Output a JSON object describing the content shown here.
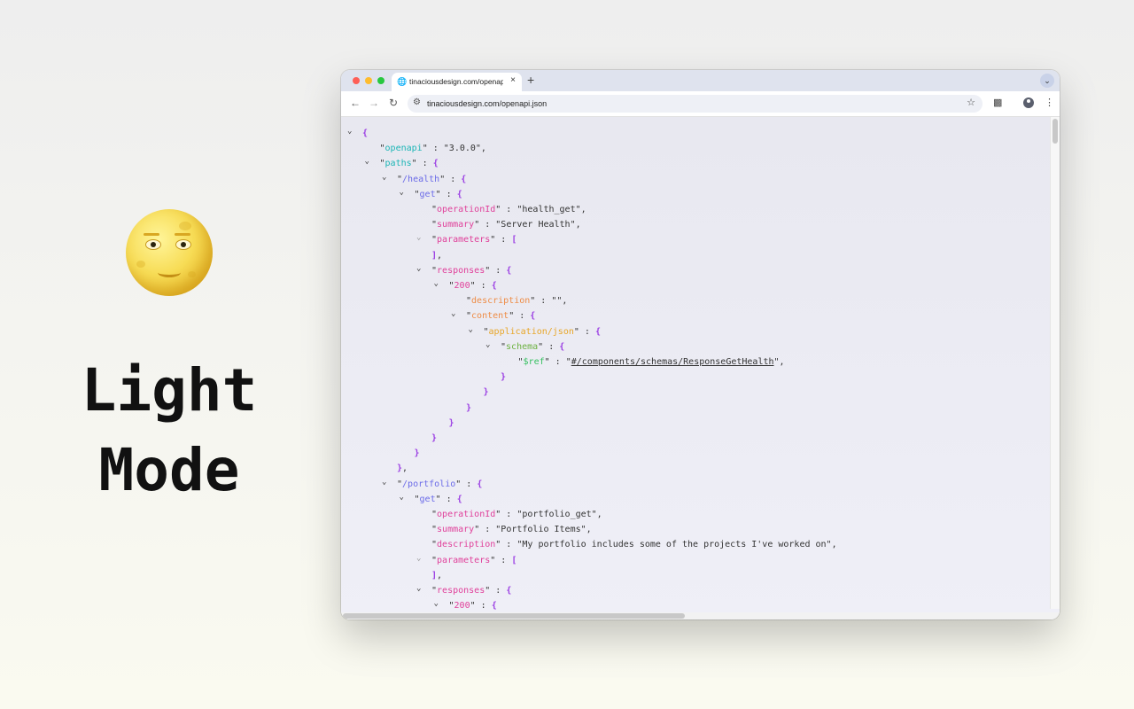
{
  "promo": {
    "line1": "Light",
    "line2": "Mode"
  },
  "browser": {
    "tab_title": "tinaciousdesign.com/openapi.json",
    "new_tab": "+",
    "tab_close": "×",
    "url": "tinaciousdesign.com/openapi.json"
  },
  "json_lines": [
    {
      "indent": 0,
      "caret": "open",
      "parts": [
        [
          "b",
          "{"
        ]
      ]
    },
    {
      "indent": 1,
      "caret": "none",
      "parts": [
        [
          "q",
          "\""
        ],
        [
          "k-teal",
          "openapi"
        ],
        [
          "q",
          "\" : "
        ],
        [
          "s",
          "\"3.0.0\","
        ]
      ]
    },
    {
      "indent": 1,
      "caret": "open",
      "parts": [
        [
          "q",
          "\""
        ],
        [
          "k-teal",
          "paths"
        ],
        [
          "q",
          "\" : "
        ],
        [
          "b",
          "{"
        ]
      ]
    },
    {
      "indent": 2,
      "caret": "open",
      "parts": [
        [
          "q",
          "\""
        ],
        [
          "k-blue",
          "/health"
        ],
        [
          "q",
          "\" : "
        ],
        [
          "b",
          "{"
        ]
      ]
    },
    {
      "indent": 3,
      "caret": "open",
      "parts": [
        [
          "q",
          "\""
        ],
        [
          "k-blue",
          "get"
        ],
        [
          "q",
          "\" : "
        ],
        [
          "b",
          "{"
        ]
      ]
    },
    {
      "indent": 4,
      "caret": "none",
      "parts": [
        [
          "q",
          "\""
        ],
        [
          "k-pink",
          "operationId"
        ],
        [
          "q",
          "\" : "
        ],
        [
          "s",
          "\"health_get\","
        ]
      ]
    },
    {
      "indent": 4,
      "caret": "none",
      "parts": [
        [
          "q",
          "\""
        ],
        [
          "k-pink",
          "summary"
        ],
        [
          "q",
          "\" : "
        ],
        [
          "s",
          "\"Server Health\","
        ]
      ]
    },
    {
      "indent": 4,
      "caret": "dim",
      "parts": [
        [
          "q",
          "\""
        ],
        [
          "k-pink",
          "parameters"
        ],
        [
          "q",
          "\" : "
        ],
        [
          "b",
          "["
        ]
      ]
    },
    {
      "indent": 4,
      "caret": "none",
      "parts": [
        [
          "b",
          "]"
        ],
        [
          "s",
          ","
        ]
      ]
    },
    {
      "indent": 4,
      "caret": "open",
      "parts": [
        [
          "q",
          "\""
        ],
        [
          "k-pink",
          "responses"
        ],
        [
          "q",
          "\" : "
        ],
        [
          "b",
          "{"
        ]
      ]
    },
    {
      "indent": 5,
      "caret": "open",
      "parts": [
        [
          "q",
          "\""
        ],
        [
          "k-pink",
          "200"
        ],
        [
          "q",
          "\" : "
        ],
        [
          "b",
          "{"
        ]
      ]
    },
    {
      "indent": 6,
      "caret": "none",
      "parts": [
        [
          "q",
          "\""
        ],
        [
          "k-orange",
          "description"
        ],
        [
          "q",
          "\" : "
        ],
        [
          "s",
          "\"\","
        ]
      ]
    },
    {
      "indent": 6,
      "caret": "open",
      "parts": [
        [
          "q",
          "\""
        ],
        [
          "k-orange",
          "content"
        ],
        [
          "q",
          "\" : "
        ],
        [
          "b",
          "{"
        ]
      ]
    },
    {
      "indent": 7,
      "caret": "open",
      "parts": [
        [
          "q",
          "\""
        ],
        [
          "k-yellow",
          "application/json"
        ],
        [
          "q",
          "\" : "
        ],
        [
          "b",
          "{"
        ]
      ]
    },
    {
      "indent": 8,
      "caret": "open",
      "parts": [
        [
          "q",
          "\""
        ],
        [
          "k-green",
          "schema"
        ],
        [
          "q",
          "\" : "
        ],
        [
          "b",
          "{"
        ]
      ]
    },
    {
      "indent": 9,
      "caret": "none",
      "parts": [
        [
          "q",
          "\""
        ],
        [
          "k-lime",
          "$ref"
        ],
        [
          "q",
          "\" : \""
        ],
        [
          "link",
          "#/components/schemas/ResponseGetHealth"
        ],
        [
          "s",
          "\","
        ]
      ]
    },
    {
      "indent": 8,
      "caret": "none",
      "parts": [
        [
          "b",
          "}"
        ]
      ]
    },
    {
      "indent": 7,
      "caret": "none",
      "parts": [
        [
          "b",
          "}"
        ]
      ]
    },
    {
      "indent": 6,
      "caret": "none",
      "parts": [
        [
          "b",
          "}"
        ]
      ]
    },
    {
      "indent": 5,
      "caret": "none",
      "parts": [
        [
          "b",
          "}"
        ]
      ]
    },
    {
      "indent": 4,
      "caret": "none",
      "parts": [
        [
          "b",
          "}"
        ]
      ]
    },
    {
      "indent": 3,
      "caret": "none",
      "parts": [
        [
          "b",
          "}"
        ]
      ]
    },
    {
      "indent": 2,
      "caret": "none",
      "parts": [
        [
          "b",
          "}"
        ],
        [
          "s",
          ","
        ]
      ]
    },
    {
      "indent": 2,
      "caret": "open",
      "parts": [
        [
          "q",
          "\""
        ],
        [
          "k-blue",
          "/portfolio"
        ],
        [
          "q",
          "\" : "
        ],
        [
          "b",
          "{"
        ]
      ]
    },
    {
      "indent": 3,
      "caret": "open",
      "parts": [
        [
          "q",
          "\""
        ],
        [
          "k-blue",
          "get"
        ],
        [
          "q",
          "\" : "
        ],
        [
          "b",
          "{"
        ]
      ]
    },
    {
      "indent": 4,
      "caret": "none",
      "parts": [
        [
          "q",
          "\""
        ],
        [
          "k-pink",
          "operationId"
        ],
        [
          "q",
          "\" : "
        ],
        [
          "s",
          "\"portfolio_get\","
        ]
      ]
    },
    {
      "indent": 4,
      "caret": "none",
      "parts": [
        [
          "q",
          "\""
        ],
        [
          "k-pink",
          "summary"
        ],
        [
          "q",
          "\" : "
        ],
        [
          "s",
          "\"Portfolio Items\","
        ]
      ]
    },
    {
      "indent": 4,
      "caret": "none",
      "parts": [
        [
          "q",
          "\""
        ],
        [
          "k-pink",
          "description"
        ],
        [
          "q",
          "\" : "
        ],
        [
          "s",
          "\"My portfolio includes some of the projects I've worked on\","
        ]
      ]
    },
    {
      "indent": 4,
      "caret": "dim",
      "parts": [
        [
          "q",
          "\""
        ],
        [
          "k-pink",
          "parameters"
        ],
        [
          "q",
          "\" : "
        ],
        [
          "b",
          "["
        ]
      ]
    },
    {
      "indent": 4,
      "caret": "none",
      "parts": [
        [
          "b",
          "]"
        ],
        [
          "s",
          ","
        ]
      ]
    },
    {
      "indent": 4,
      "caret": "open",
      "parts": [
        [
          "q",
          "\""
        ],
        [
          "k-pink",
          "responses"
        ],
        [
          "q",
          "\" : "
        ],
        [
          "b",
          "{"
        ]
      ]
    },
    {
      "indent": 5,
      "caret": "open",
      "parts": [
        [
          "q",
          "\""
        ],
        [
          "k-pink",
          "200"
        ],
        [
          "q",
          "\" : "
        ],
        [
          "b",
          "{"
        ]
      ]
    }
  ]
}
